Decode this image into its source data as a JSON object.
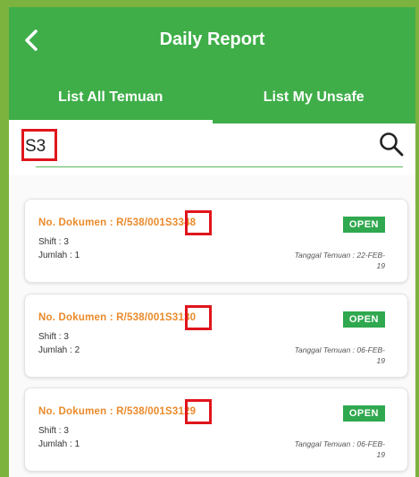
{
  "header": {
    "title": "Daily Report"
  },
  "tabs": [
    {
      "label": "List All Temuan",
      "active": true
    },
    {
      "label": "List My Unsafe",
      "active": false
    }
  ],
  "search": {
    "value": "S3"
  },
  "cards": [
    {
      "doc_prefix": "No. Dokumen : R/538/001",
      "doc_highlight": "S3",
      "doc_suffix": "348",
      "shift": "Shift : 3",
      "jumlah": "Jumlah : 1",
      "status": "OPEN",
      "date": "Tanggal Temuan : 22-FEB-19"
    },
    {
      "doc_prefix": "No. Dokumen : R/538/001",
      "doc_highlight": "S3",
      "doc_suffix": "130",
      "shift": "Shift : 3",
      "jumlah": "Jumlah : 2",
      "status": "OPEN",
      "date": "Tanggal Temuan : 06-FEB-19"
    },
    {
      "doc_prefix": "No. Dokumen : R/538/001",
      "doc_highlight": "S3",
      "doc_suffix": "129",
      "shift": "Shift : 3",
      "jumlah": "Jumlah : 1",
      "status": "OPEN",
      "date": "Tanggal Temuan : 06-FEB-19"
    }
  ],
  "colors": {
    "primary": "#3fae49",
    "doc_number": "#ea8a2a",
    "status_open": "#2fa84f",
    "highlight_box": "#e0151c"
  }
}
